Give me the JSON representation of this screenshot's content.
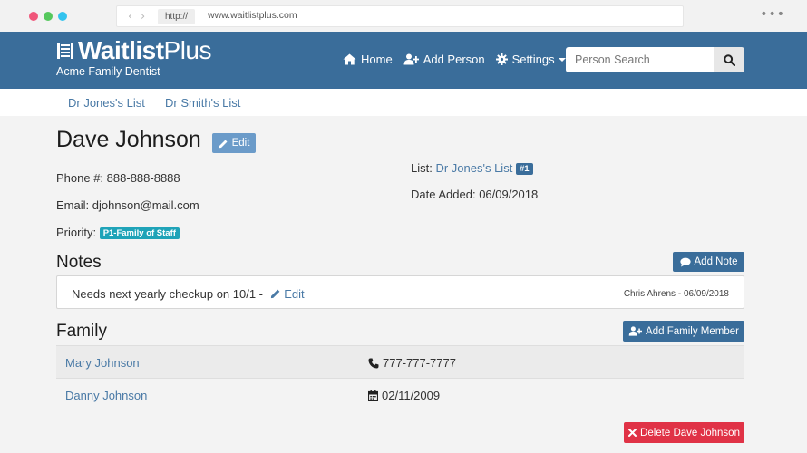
{
  "browser": {
    "protocol": "http://",
    "url": "www.waitlistplus.com"
  },
  "brand": {
    "name_bold": "Waitlist",
    "name_light": "Plus",
    "subtitle": "Acme Family Dentist"
  },
  "nav": {
    "home": "Home",
    "add_person": "Add Person",
    "settings": "Settings"
  },
  "search": {
    "placeholder": "Person Search"
  },
  "lists": [
    "Dr Jones's List",
    "Dr Smith's List"
  ],
  "person": {
    "name": "Dave Johnson",
    "edit_label": "Edit",
    "phone_label": "Phone #:",
    "phone": "888-888-8888",
    "email_label": "Email:",
    "email": "djohnson@mail.com",
    "priority_label": "Priority:",
    "priority": "P1-Family of Staff",
    "list_label": "List:",
    "list": "Dr Jones's List",
    "list_position": "#1",
    "date_added_label": "Date Added:",
    "date_added": "06/09/2018"
  },
  "notes": {
    "heading": "Notes",
    "add_label": "Add Note",
    "items": [
      {
        "text": "Needs next yearly checkup on 10/1 -",
        "edit_label": "Edit",
        "meta": "Chris Ahrens - 06/09/2018"
      }
    ]
  },
  "family": {
    "heading": "Family",
    "add_label": "Add Family Member",
    "members": [
      {
        "name": "Mary Johnson",
        "detail": "777-777-7777",
        "icon": "phone-icon"
      },
      {
        "name": "Danny Johnson",
        "detail": "02/11/2009",
        "icon": "calendar-icon"
      }
    ]
  },
  "delete_label": "Delete Dave Johnson",
  "colors": {
    "header": "#3a6d9a",
    "edit_button": "#6b9bc9",
    "priority_badge": "#1fa3b8",
    "delete_button": "#e03246",
    "link": "#4a7aa6"
  }
}
